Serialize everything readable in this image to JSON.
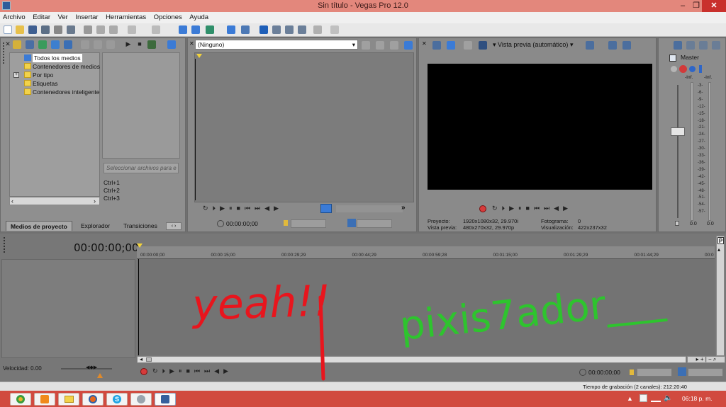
{
  "window": {
    "title": "Sin título - Vegas Pro 12.0",
    "buttons": {
      "minimize": "–",
      "restore": "❐",
      "close": "✕"
    }
  },
  "menu": [
    "Archivo",
    "Editar",
    "Ver",
    "Insertar",
    "Herramientas",
    "Opciones",
    "Ayuda"
  ],
  "explorer": {
    "tree": [
      "Todos los medios",
      "Contenedores de medios",
      "Por tipo",
      "Etiquetas",
      "Contenedores inteligente"
    ],
    "search_placeholder": "Seleccionar archivos para e",
    "shortcuts": [
      "Ctrl+1",
      "Ctrl+2",
      "Ctrl+3"
    ],
    "tabs": [
      "Medios de proyecto",
      "Explorador",
      "Transiciones"
    ]
  },
  "trimmer": {
    "dropdown": "(Ninguno)",
    "timecode": "00:00:00;00",
    "tail": "»"
  },
  "preview": {
    "mode": "Vista previa (automático)",
    "info": {
      "proyecto_label": "Proyecto:",
      "proyecto_value": "1920x1080x32, 29.970i",
      "vista_label": "Vista previa:",
      "vista_value": "480x270x32, 29.970p",
      "fotograma_label": "Fotograma:",
      "fotograma_value": "0",
      "visualizacion_label": "Visualización:",
      "visualizacion_value": "422x237x32"
    }
  },
  "mixer": {
    "title": "Master",
    "peak_left": "-Inf.",
    "peak_right": "-Inf.",
    "scale": [
      "3",
      "6",
      "9",
      "12",
      "15",
      "18",
      "21",
      "24",
      "27",
      "30",
      "33",
      "36",
      "39",
      "42",
      "45",
      "48",
      "51",
      "54",
      "57"
    ],
    "value_left": "0.0",
    "value_right": "0.0"
  },
  "timeline": {
    "timecode": "00:00:00;00",
    "ruler": [
      "00:00:00;00",
      "00:00:15;00",
      "00:00:29;29",
      "00:00:44;29",
      "00:00:59;28",
      "00:01:15;00",
      "00:01:29;29",
      "00:01:44;29",
      "00:0"
    ],
    "velocidad": "Velocidad: 0.00",
    "transport_timecode": "00:00:00;00",
    "status": "Tiempo de grabación (2 canales): 212:20:40"
  },
  "overlay": {
    "red_text": "yeah!!",
    "green_text": "pixis7ador___"
  },
  "taskbar": {
    "time": "06:18 p. m.",
    "apps": [
      "chrome",
      "media-player",
      "file-explorer",
      "firefox",
      "skype",
      "vlc-player",
      "vegas-pro"
    ]
  },
  "colors": {
    "title_bar": "#e3877c",
    "taskbar": "#d14a3f",
    "red_scribble": "#e8151d",
    "green_scribble": "#2ec42e",
    "selection": "#3b7bd6"
  }
}
